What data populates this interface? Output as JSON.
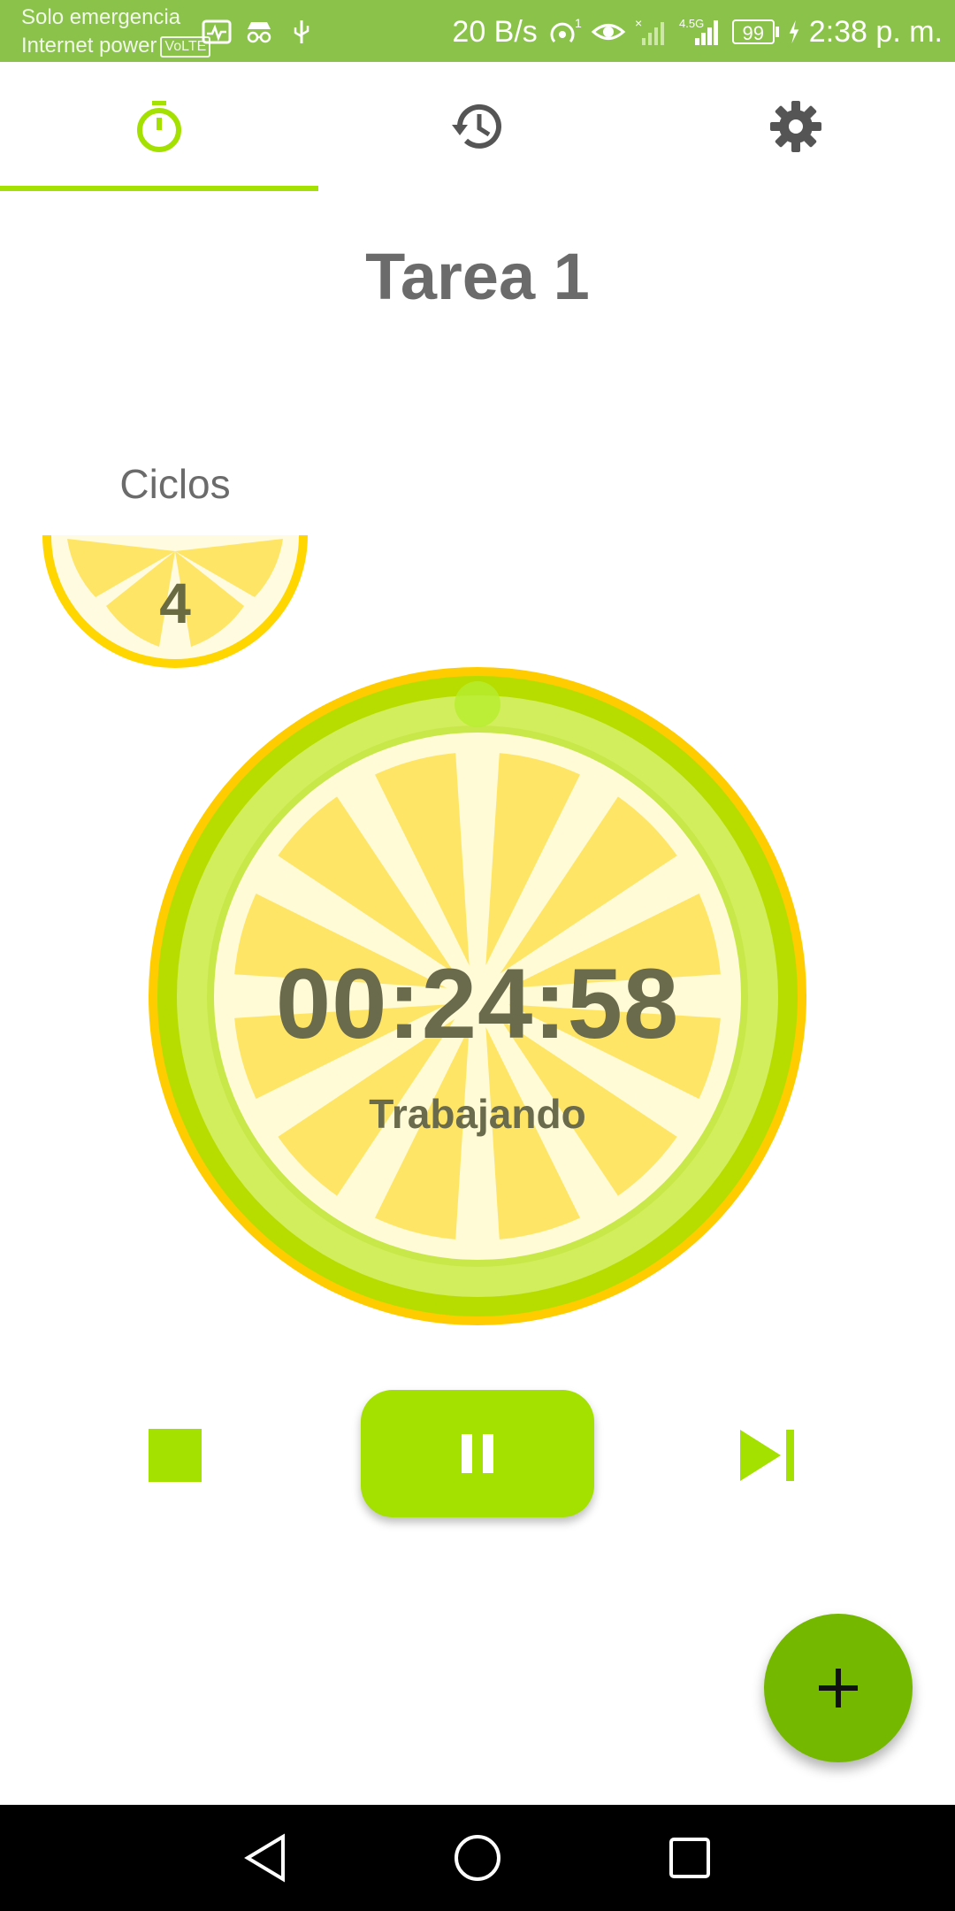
{
  "status_bar": {
    "line1": "Solo emergencia",
    "line2": "Internet power",
    "volte": "VoLTE",
    "net_speed": "20 B/s",
    "hotspot_badge": "1",
    "data_type": "4.5G",
    "battery": "99",
    "time": "2:38 p. m.",
    "icons": [
      "activity-icon",
      "incognito-icon",
      "usb-icon",
      "hotspot-icon",
      "eye-icon",
      "signal-x-icon",
      "signal-icon",
      "battery-icon",
      "charging-icon"
    ]
  },
  "tabs": [
    {
      "name": "timer",
      "icon": "stopwatch-icon",
      "active": true
    },
    {
      "name": "history",
      "icon": "history-icon",
      "active": false
    },
    {
      "name": "settings",
      "icon": "gear-icon",
      "active": false
    }
  ],
  "task": {
    "title": "Tarea 1"
  },
  "cycles": {
    "label": "Ciclos",
    "count": "4"
  },
  "timer": {
    "time": "00:24:58",
    "state": "Trabajando"
  },
  "controls": {
    "stop": "stop-icon",
    "pause": "pause-icon",
    "skip": "skip-next-icon"
  },
  "fab": {
    "icon": "plus-icon"
  },
  "navbar": [
    "back-icon",
    "home-icon",
    "recents-icon"
  ],
  "colors": {
    "status_bar": "#8bc34a",
    "accent": "#a4e000",
    "fab": "#74b800",
    "text_gray": "#6b6b6b",
    "lemon_yellow": "#ffe566",
    "lime_rind": "#c8e85a"
  }
}
